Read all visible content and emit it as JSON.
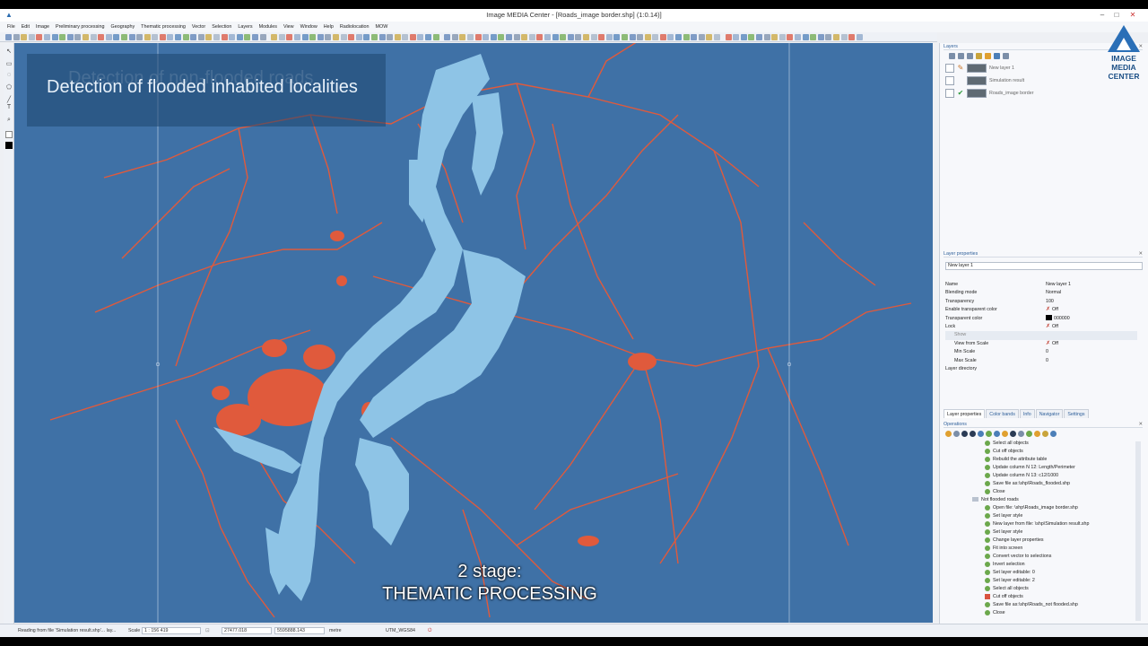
{
  "window": {
    "title": "Image MEDIA Center - [Roads_image border.shp]   (1:0.14)]",
    "controls": [
      "–",
      "□",
      "✕"
    ]
  },
  "menu": [
    "File",
    "Edit",
    "Image",
    "Preliminary processing",
    "Geography",
    "Thematic processing",
    "Vector",
    "Selection",
    "Layers",
    "Modules",
    "View",
    "Window",
    "Help",
    "Radiolocation",
    "MOW"
  ],
  "overlay": {
    "ghost_text": "Detection of non-flooded roads",
    "banner_text": "Detection of flooded inhabited localities",
    "subtitle_line1": "2 stage:",
    "subtitle_line2": "THEMATIC PROCESSING"
  },
  "colors": {
    "map_background": "#3f71a6",
    "water": "#8ec4e6",
    "roads": "#e05a3c",
    "accent": "#2e5f9a"
  },
  "logo": {
    "line1": "IMAGE",
    "line2": "MEDIA",
    "line3": "CENTER"
  },
  "layers_panel": {
    "title": "Layers",
    "close": "✕",
    "layers": [
      {
        "name": "New layer 1",
        "editable": true
      },
      {
        "name": "Simulation result",
        "editable": false
      },
      {
        "name": "Roads_image border",
        "editable": true
      }
    ]
  },
  "layer_properties": {
    "title": "Layer properties",
    "selected_layer": "New layer 1",
    "rows": [
      {
        "key": "Name",
        "value": "New layer 1"
      },
      {
        "key": "Blending mode",
        "value": "Normal"
      },
      {
        "key": "Transparency",
        "value": "100"
      },
      {
        "key": "Enable transparent color",
        "value": "Off"
      },
      {
        "key": "Transparent color",
        "value": "000000"
      },
      {
        "key": "Lock",
        "value": "Off"
      },
      {
        "key": "Show",
        "value": ""
      },
      {
        "key": "View from Scale",
        "value": "Off"
      },
      {
        "key": "Min Scale",
        "value": "0"
      },
      {
        "key": "Max Scale",
        "value": "0"
      },
      {
        "key": "Layer directory",
        "value": ""
      }
    ]
  },
  "tabs": [
    "Layer properties",
    "Color bands",
    "Info",
    "Navigator",
    "Settings"
  ],
  "operations": {
    "title": "Operations",
    "items": [
      {
        "label": "Select all objects",
        "level": 2,
        "icon": "gear"
      },
      {
        "label": "Cut off objects",
        "level": 2,
        "icon": "gear"
      },
      {
        "label": "Rebuild the attribute table",
        "level": 2,
        "icon": "gear"
      },
      {
        "label": "Update column N 12: Length/Perimeter",
        "level": 2,
        "icon": "gear"
      },
      {
        "label": "Update column N 13: c12/1000",
        "level": 2,
        "icon": "gear"
      },
      {
        "label": "Save file as:\\shp\\Roads_flooded.shp",
        "level": 2,
        "icon": "gear"
      },
      {
        "label": "Close",
        "level": 2,
        "icon": "gear"
      },
      {
        "label": "Not flooded roads",
        "level": 1,
        "icon": "folder"
      },
      {
        "label": "Open file: \\shp\\Roads_image border.shp",
        "level": 2,
        "icon": "gear"
      },
      {
        "label": "Set layer style",
        "level": 2,
        "icon": "gear"
      },
      {
        "label": "New layer from file: \\shp\\Simulation result.shp",
        "level": 2,
        "icon": "gear"
      },
      {
        "label": "Set layer style",
        "level": 2,
        "icon": "gear"
      },
      {
        "label": "Change layer properties",
        "level": 2,
        "icon": "gear"
      },
      {
        "label": "Fit into screen",
        "level": 2,
        "icon": "gear"
      },
      {
        "label": "Convert vector to selections",
        "level": 2,
        "icon": "gear"
      },
      {
        "label": "Invert selection",
        "level": 2,
        "icon": "gear"
      },
      {
        "label": "Set layer editable: 0",
        "level": 2,
        "icon": "gear"
      },
      {
        "label": "Set layer editable: 2",
        "level": 2,
        "icon": "gear"
      },
      {
        "label": "Select all objects",
        "level": 2,
        "icon": "gear"
      },
      {
        "label": "Cut off objects",
        "level": 2,
        "icon": "red"
      },
      {
        "label": "Save file as:\\shp\\Roads_not flooded.shp",
        "level": 2,
        "icon": "gear"
      },
      {
        "label": "Close",
        "level": 2,
        "icon": "gear"
      }
    ]
  },
  "status": {
    "message": "Reading from file 'Simulation result.shp'... lay...",
    "scale_label": "Scale",
    "scale_value": "1 : 156 419",
    "x": "27477.018",
    "y": "5595888.143",
    "units": "metre",
    "projection": "UTM_WGS84"
  }
}
